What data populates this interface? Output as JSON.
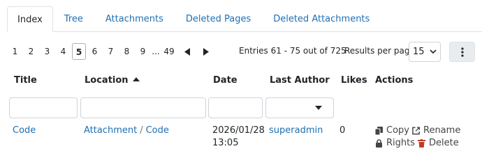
{
  "tabs": [
    {
      "label": "Index"
    },
    {
      "label": "Tree"
    },
    {
      "label": "Attachments"
    },
    {
      "label": "Deleted Pages"
    },
    {
      "label": "Deleted Attachments"
    }
  ],
  "pagination": {
    "pages": [
      "1",
      "2",
      "3",
      "4",
      "5",
      "6",
      "7",
      "8",
      "9"
    ],
    "current_page": "5",
    "ellipsis": "...",
    "last_page": "49",
    "entries_text": "Entries 61 - 75 out of 725"
  },
  "results_per_page": {
    "label": "Results per page:",
    "value": "15"
  },
  "table": {
    "headers": {
      "title": "Title",
      "location": "Location",
      "date": "Date",
      "author": "Last Author",
      "likes": "Likes",
      "actions": "Actions"
    },
    "row": {
      "title": "Code",
      "location_parent": "Attachment",
      "location_separator": "/",
      "location_child": "Code",
      "date": "2026/01/28",
      "time": "13:05",
      "author": "superadmin",
      "likes": "0",
      "actions": {
        "copy": "Copy",
        "rename": "Rename",
        "rights": "Rights",
        "delete": "Delete"
      }
    }
  },
  "colors": {
    "link": "#1f6fb2",
    "delete_icon": "#c0392b"
  }
}
